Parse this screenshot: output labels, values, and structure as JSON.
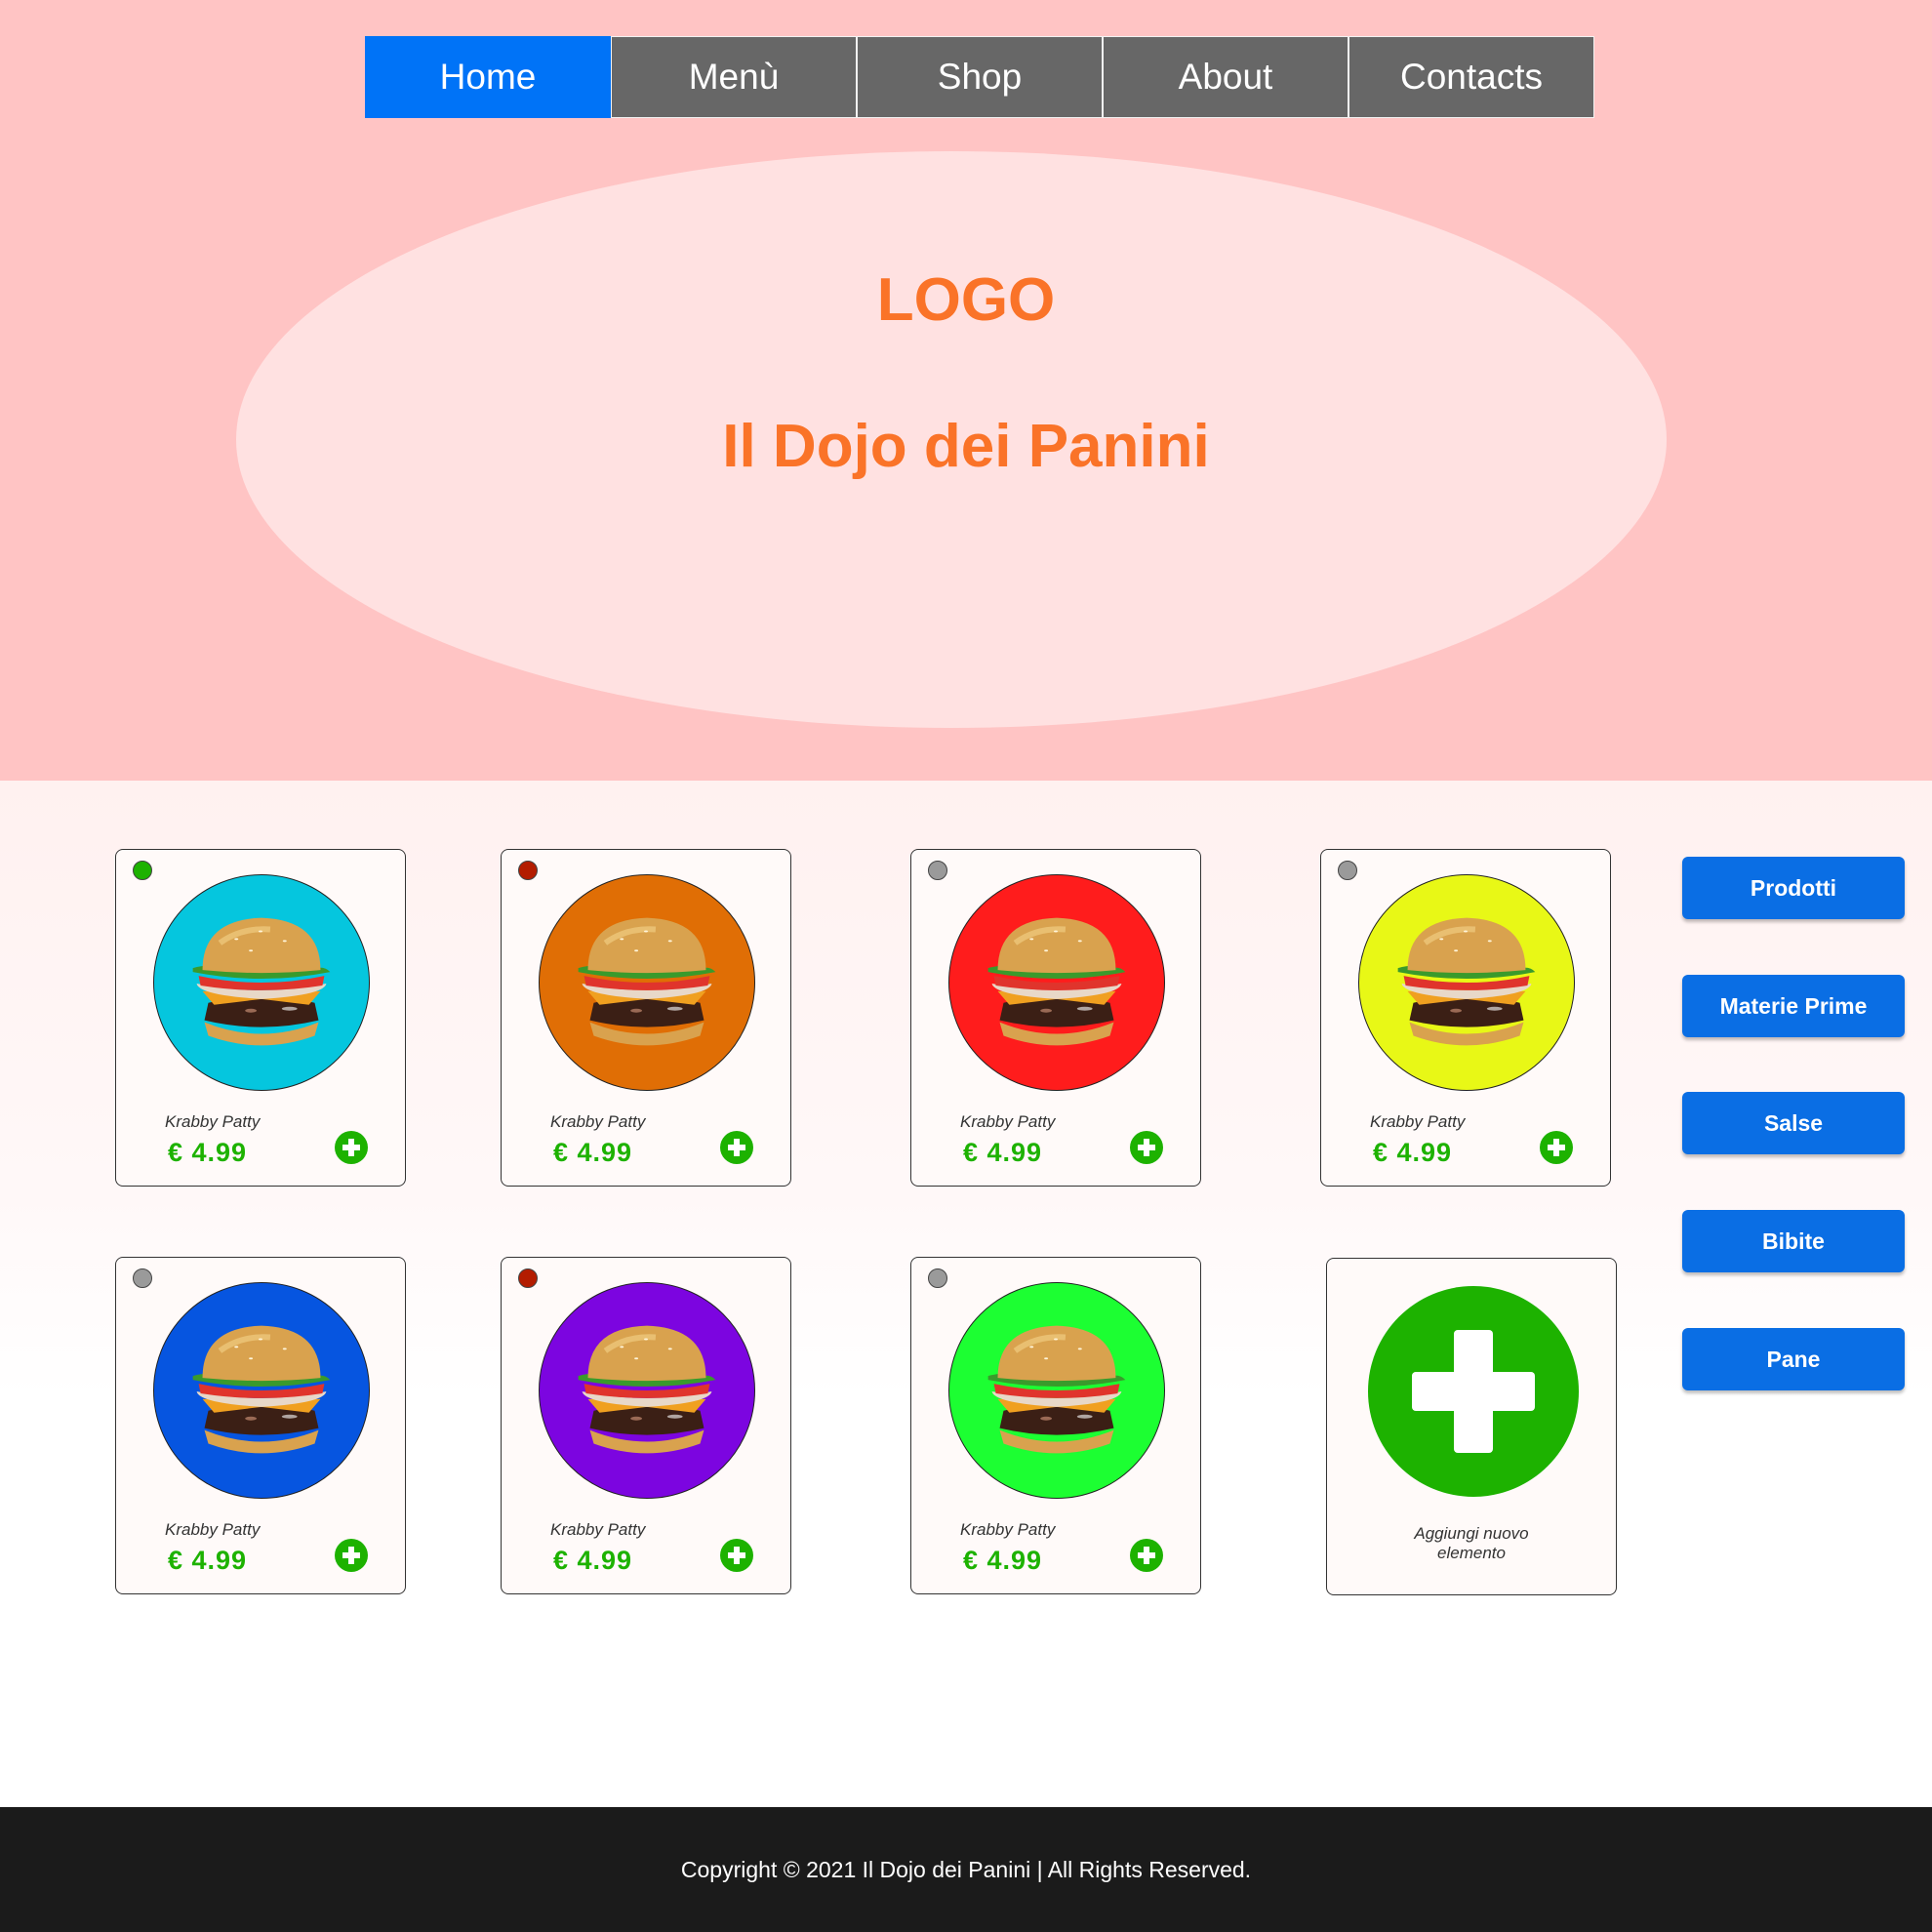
{
  "nav": {
    "items": [
      {
        "label": "Home",
        "active": true
      },
      {
        "label": "Menù",
        "active": false
      },
      {
        "label": "Shop",
        "active": false
      },
      {
        "label": "About",
        "active": false
      },
      {
        "label": "Contacts",
        "active": false
      }
    ]
  },
  "hero": {
    "logo": "LOGO",
    "title": "Il Dojo dei Panini"
  },
  "products": [
    {
      "name": "Krabby Patty",
      "price": "€ 4.99",
      "status": "green",
      "bg": "#05c6de"
    },
    {
      "name": "Krabby Patty",
      "price": "€ 4.99",
      "status": "red",
      "bg": "#e06e05"
    },
    {
      "name": "Krabby Patty",
      "price": "€ 4.99",
      "status": "gray",
      "bg": "#ff1c1c"
    },
    {
      "name": "Krabby Patty",
      "price": "€ 4.99",
      "status": "gray",
      "bg": "#e8f816"
    },
    {
      "name": "Krabby Patty",
      "price": "€ 4.99",
      "status": "gray",
      "bg": "#0655e0"
    },
    {
      "name": "Krabby Patty",
      "price": "€ 4.99",
      "status": "red",
      "bg": "#7c05e0"
    },
    {
      "name": "Krabby Patty",
      "price": "€ 4.99",
      "status": "gray",
      "bg": "#1cff32"
    }
  ],
  "add_card": {
    "label_line1": "Aggiungi nuovo",
    "label_line2": "elemento"
  },
  "categories": [
    "Prodotti",
    "Materie Prime",
    "Salse",
    "Bibite",
    "Pane"
  ],
  "footer": {
    "text": "Copyright © 2021 Il Dojo dei Panini | All Rights Reserved."
  },
  "colors": {
    "nav_active": "#0073f7",
    "nav_inactive": "#676767",
    "accent_orange": "#fa7328",
    "price_green": "#1db200",
    "category_blue": "#0a6ee4",
    "status_green": "#1db200",
    "status_red": "#b31c00",
    "status_gray": "#9a9a9a"
  }
}
